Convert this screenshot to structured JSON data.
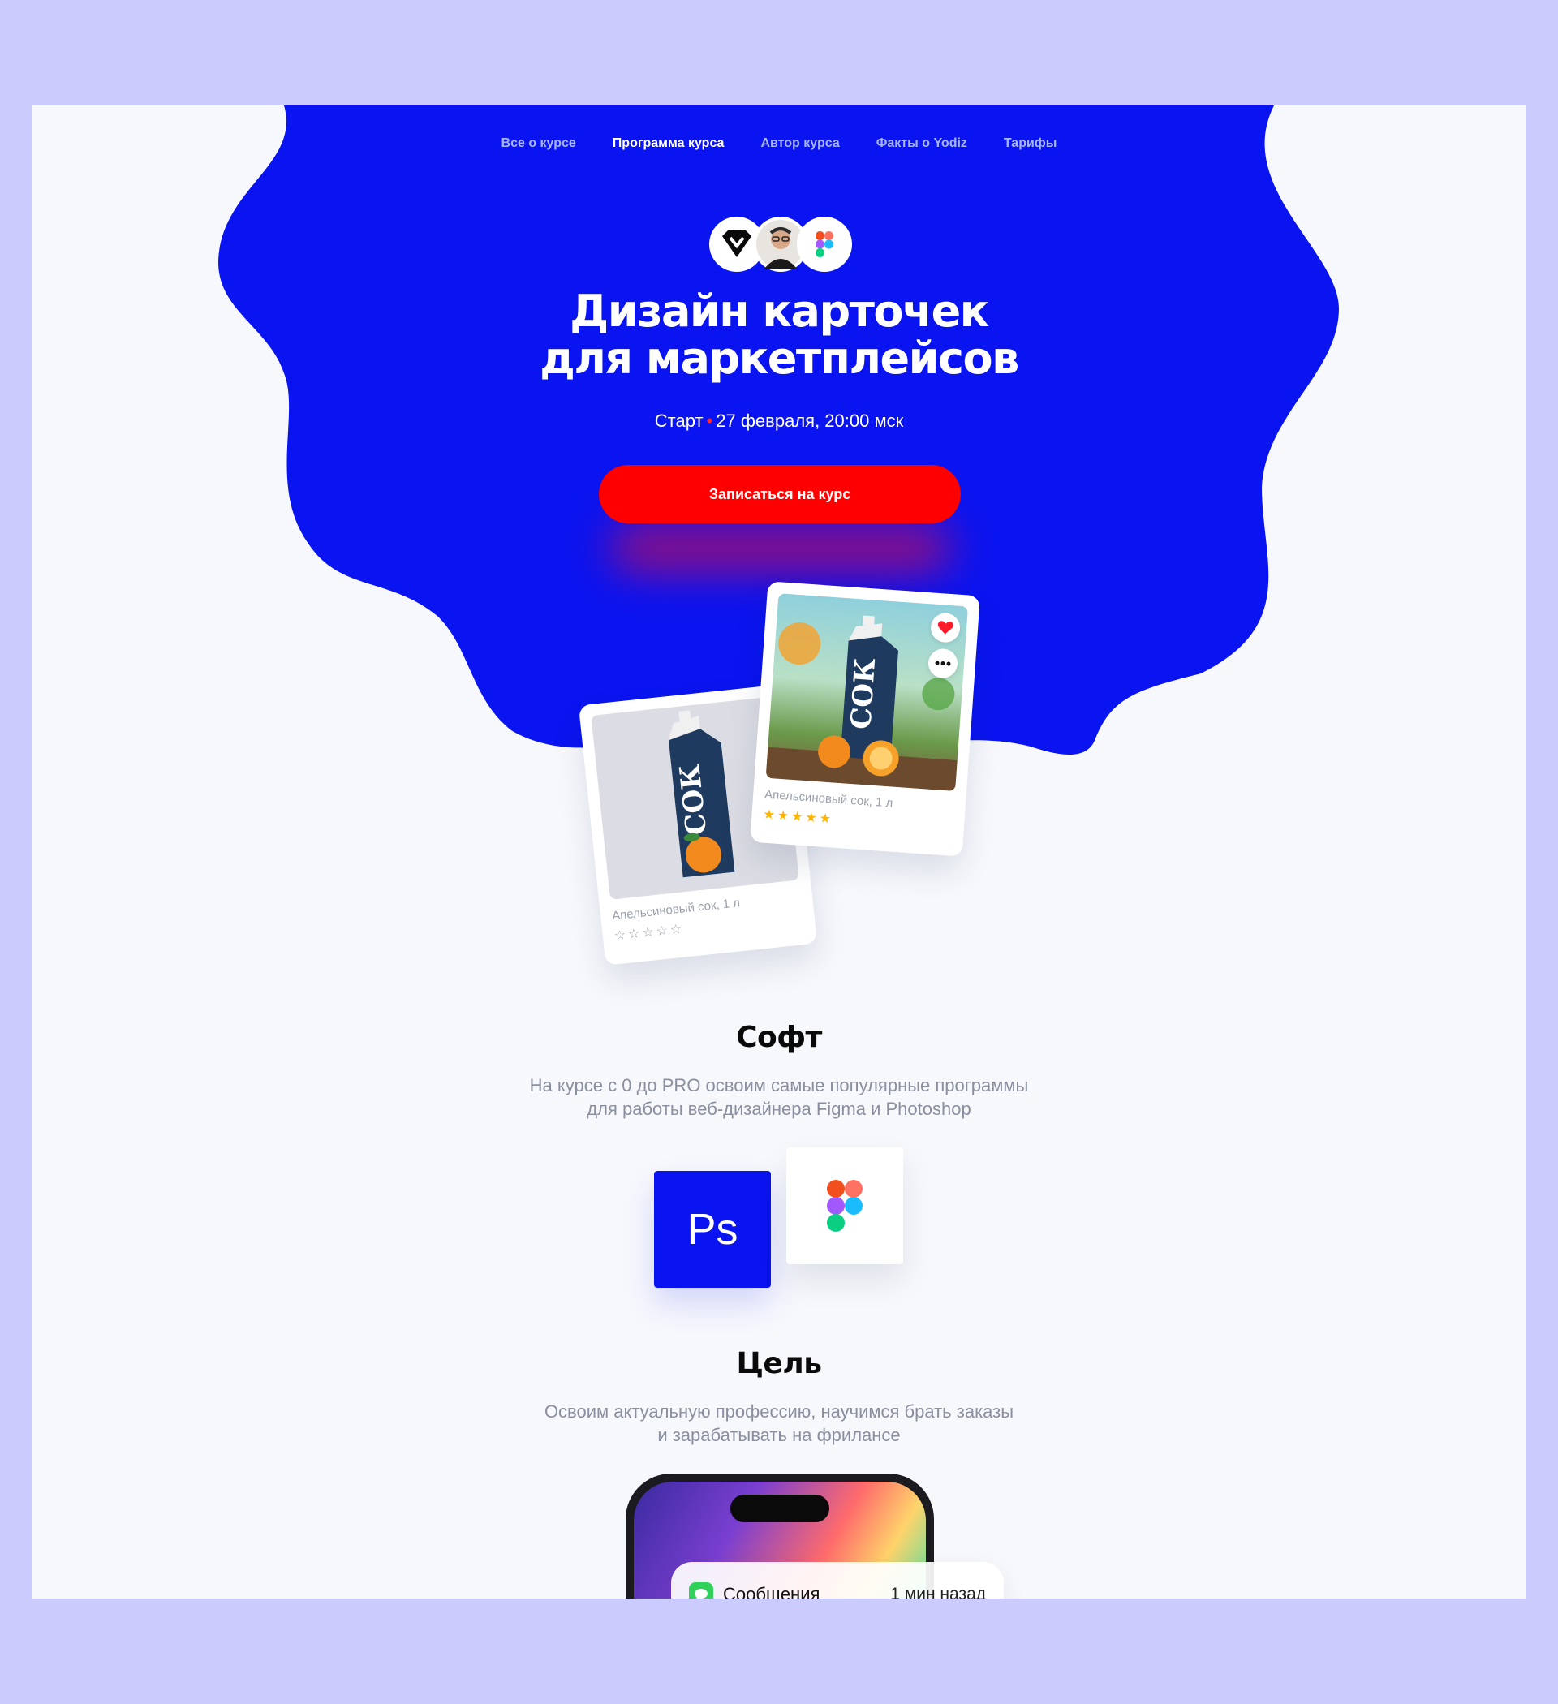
{
  "nav": {
    "items": [
      "Все о курсе",
      "Программа курса",
      "Автор курса",
      "Факты о Yodiz",
      "Тарифы"
    ],
    "active_index": 1
  },
  "hero": {
    "title_line1": "Дизайн карточек",
    "title_line2": "для маркетплейсов",
    "start_label": "Старт",
    "start_date": "27 февраля, 20:00 мск",
    "cta_label": "Записаться на курс"
  },
  "cards": {
    "left": {
      "caption": "Апельсиновый сок, 1 л",
      "product_text": "СОК",
      "rating": 0,
      "stars": "☆☆☆☆☆"
    },
    "right": {
      "caption": "Апельсиновый сок, 1 л",
      "product_text": "СОК",
      "rating": 5,
      "stars": "★★★★★"
    }
  },
  "soft": {
    "title": "Софт",
    "text_line1": "На курсе с 0 до PRO освоим самые популярные программы",
    "text_line2": "для работы веб-дизайнера Figma и Photoshop",
    "ps_label": "Ps",
    "icons": [
      "photoshop-icon",
      "figma-icon"
    ]
  },
  "goal": {
    "title": "Цель",
    "text_line1": "Освоим актуальную профессию, научимся брать заказы",
    "text_line2": "и зарабатывать на фрилансе"
  },
  "notification": {
    "app": "Сообщения",
    "time": "1 мин назад"
  },
  "colors": {
    "blue": "#0a14f0",
    "red": "#ff0000",
    "background": "#cccbfd",
    "page": "#f7f8fc"
  }
}
